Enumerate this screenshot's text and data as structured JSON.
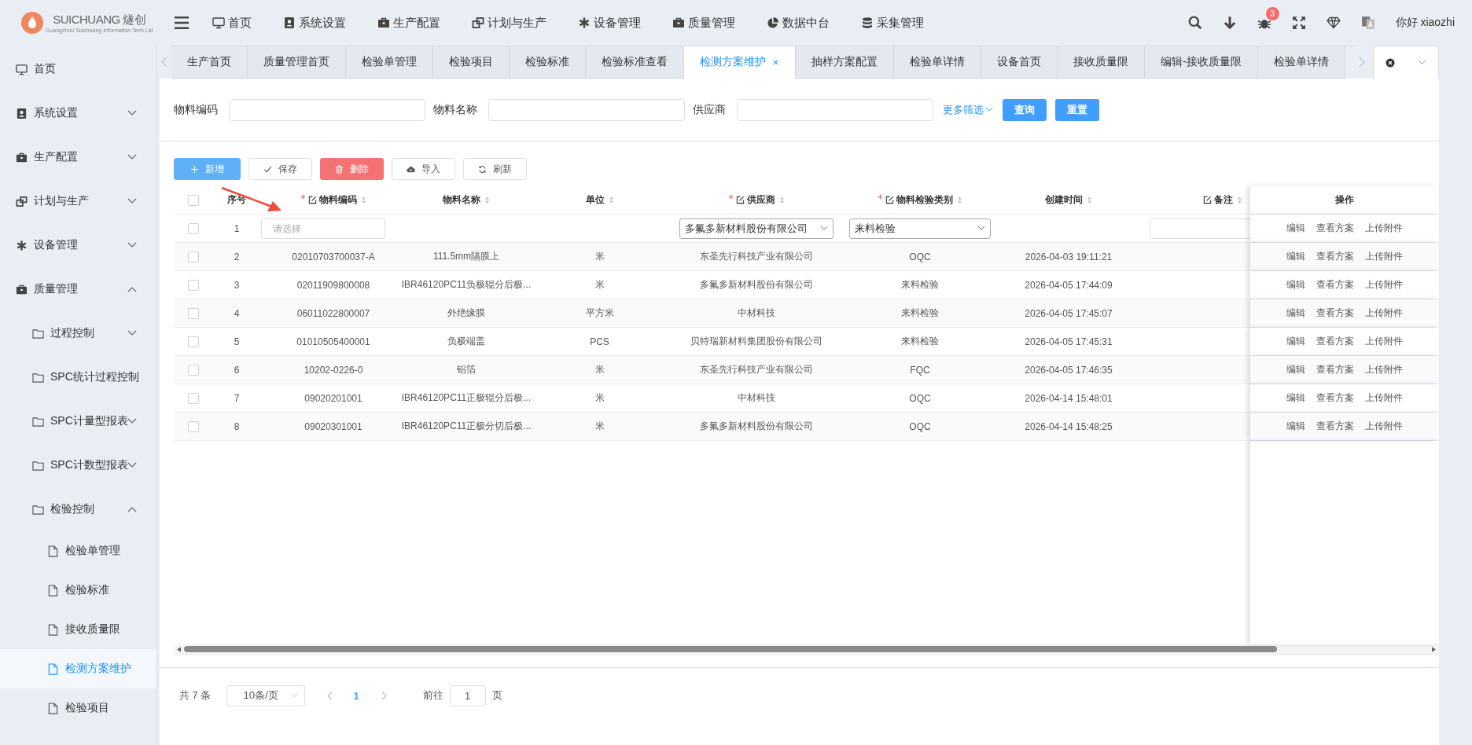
{
  "logo": {
    "brand": "SUICHUANG 燧创",
    "subtitle": "Guangzhou Suichuang Information Tech Ltd"
  },
  "top_nav": [
    "首页",
    "系统设置",
    "生产配置",
    "计划与生产",
    "设备管理",
    "质量管理",
    "数据中台",
    "采集管理"
  ],
  "notification_count": "3",
  "user_greeting": "你好 xiaozhi",
  "sidebar": {
    "items": [
      {
        "label": "首页"
      },
      {
        "label": "系统设置",
        "expanded": false
      },
      {
        "label": "生产配置",
        "expanded": false
      },
      {
        "label": "计划与生产",
        "expanded": false
      },
      {
        "label": "设备管理",
        "expanded": false
      },
      {
        "label": "质量管理",
        "expanded": true,
        "children": [
          {
            "label": "过程控制",
            "expanded": false
          },
          {
            "label": "SPC统计过程控制"
          },
          {
            "label": "SPC计量型报表",
            "expanded": false
          },
          {
            "label": "SPC计数型报表",
            "expanded": false
          },
          {
            "label": "检验控制",
            "expanded": true,
            "children": [
              {
                "label": "检验单管理",
                "selected": false
              },
              {
                "label": "检验标准",
                "selected": false
              },
              {
                "label": "接收质量限",
                "selected": false
              },
              {
                "label": "检测方案维护",
                "selected": true
              },
              {
                "label": "检验项目",
                "selected": false
              }
            ]
          }
        ]
      }
    ]
  },
  "tabs": [
    {
      "label": "生产首页",
      "selected": false
    },
    {
      "label": "质量管理首页",
      "selected": false
    },
    {
      "label": "检验单管理",
      "selected": false
    },
    {
      "label": "检验项目",
      "selected": false
    },
    {
      "label": "检验标准",
      "selected": false
    },
    {
      "label": "检验标准查看",
      "selected": false
    },
    {
      "label": "检测方案维护",
      "selected": true
    },
    {
      "label": "抽样方案配置",
      "selected": false
    },
    {
      "label": "检验单详情",
      "selected": false
    },
    {
      "label": "设备首页",
      "selected": false
    },
    {
      "label": "接收质量限",
      "selected": false
    },
    {
      "label": "编辑-接收质量限",
      "selected": false
    },
    {
      "label": "检验单详情",
      "selected": false
    }
  ],
  "filters": [
    {
      "label": "物料编码"
    },
    {
      "label": "物料名称"
    },
    {
      "label": "供应商"
    }
  ],
  "more_filters": "更多筛选",
  "filter_buttons": [
    "查询",
    "重置"
  ],
  "toolbar": [
    {
      "label": "新增",
      "kind": "primary"
    },
    {
      "label": "保存",
      "kind": "default"
    },
    {
      "label": "删除",
      "kind": "danger"
    },
    {
      "label": "导入",
      "kind": "default"
    },
    {
      "label": "刷新",
      "kind": "default"
    }
  ],
  "table": {
    "header_checked": false,
    "columns": [
      {
        "label": "序号",
        "required": false,
        "editable": false,
        "sortable": false
      },
      {
        "label": "物料编码",
        "required": true,
        "editable": true,
        "sortable": true
      },
      {
        "label": "物料名称",
        "required": false,
        "editable": false,
        "sortable": true
      },
      {
        "label": "单位",
        "required": false,
        "editable": false,
        "sortable": true
      },
      {
        "label": "供应商",
        "required": true,
        "editable": true,
        "sortable": true
      },
      {
        "label": "物料检验类别",
        "required": true,
        "editable": true,
        "sortable": true
      },
      {
        "label": "创建时间",
        "required": false,
        "editable": false,
        "sortable": true
      },
      {
        "label": "备注",
        "required": false,
        "editable": true,
        "sortable": true
      },
      {
        "label": "操作",
        "required": false,
        "editable": false,
        "sortable": false
      }
    ],
    "rows": [
      {
        "kind": "edit",
        "checked": false,
        "index": "1",
        "code_placeholder": "请选择",
        "supplier": "多氟多新材料股份有限公司",
        "category": "来料检验",
        "actions": [
          "编辑",
          "查看方案",
          "上传附件"
        ]
      },
      {
        "kind": "data",
        "checked": false,
        "index": "2",
        "code": "02010703700037-A",
        "name": "111.5mm隔膜上",
        "unit": "米",
        "supplier": "东圣先行科技产业有限公司",
        "category": "OQC",
        "created": "2026-04-03 19:11:21",
        "actions": [
          "编辑",
          "查看方案",
          "上传附件"
        ]
      },
      {
        "kind": "data",
        "checked": false,
        "index": "3",
        "code": "02011909800008",
        "name": "IBR46120PC11负极辊分后极...",
        "unit": "米",
        "supplier": "多氟多新材料股份有限公司",
        "category": "来料检验",
        "created": "2026-04-05 17:44:09",
        "actions": [
          "编辑",
          "查看方案",
          "上传附件"
        ]
      },
      {
        "kind": "data",
        "checked": false,
        "index": "4",
        "code": "06011022800007",
        "name": "外绝缘膜",
        "unit": "平方米",
        "supplier": "中材科技",
        "category": "来料检验",
        "created": "2026-04-05 17:45:07",
        "actions": [
          "编辑",
          "查看方案",
          "上传附件"
        ]
      },
      {
        "kind": "data",
        "checked": false,
        "index": "5",
        "code": "01010505400001",
        "name": "负极端盖",
        "unit": "PCS",
        "supplier": "贝特瑞新材料集团股份有限公司",
        "category": "来料检验",
        "created": "2026-04-05 17:45:31",
        "actions": [
          "编辑",
          "查看方案",
          "上传附件"
        ]
      },
      {
        "kind": "data",
        "checked": false,
        "index": "6",
        "code": "10202-0226-0",
        "name": "铝箔",
        "unit": "米",
        "supplier": "东圣先行科技产业有限公司",
        "category": "FQC",
        "created": "2026-04-05 17:46:35",
        "actions": [
          "编辑",
          "查看方案",
          "上传附件"
        ]
      },
      {
        "kind": "data",
        "checked": false,
        "index": "7",
        "code": "09020201001",
        "name": "IBR46120PC11正极辊分后极...",
        "unit": "米",
        "supplier": "中材科技",
        "category": "OQC",
        "created": "2026-04-14 15:48:01",
        "actions": [
          "编辑",
          "查看方案",
          "上传附件"
        ]
      },
      {
        "kind": "data",
        "checked": false,
        "index": "8",
        "code": "09020301001",
        "name": "IBR46120PC11正极分切后极...",
        "unit": "米",
        "supplier": "多氟多新材料股份有限公司",
        "category": "OQC",
        "created": "2026-04-14 15:48:25",
        "actions": [
          "编辑",
          "查看方案",
          "上传附件"
        ]
      }
    ]
  },
  "pagination": {
    "total": "共 7 条",
    "page_size": "10条/页",
    "pages": [
      {
        "label": "1",
        "selected": true
      }
    ],
    "jump_label": "前往",
    "jump_value": "1",
    "jump_suffix": "页"
  }
}
